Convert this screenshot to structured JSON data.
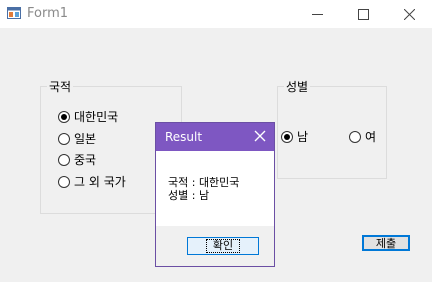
{
  "window": {
    "title": "Form1"
  },
  "nationality": {
    "title": "국적",
    "options": [
      {
        "label": "대한민국",
        "checked": true
      },
      {
        "label": "일본",
        "checked": false
      },
      {
        "label": "중국",
        "checked": false
      },
      {
        "label": "그 외 국가",
        "checked": false
      }
    ]
  },
  "gender": {
    "title": "성별",
    "options": [
      {
        "label": "남",
        "checked": true
      },
      {
        "label": "여",
        "checked": false
      }
    ]
  },
  "submit_label": "제출",
  "dialog": {
    "title": "Result",
    "line1": "국적 : 대한민국",
    "line2": "성별 : 남",
    "ok_label": "확인"
  },
  "colors": {
    "dialog_title_bg": "#7e57c2",
    "focus_border": "#0078d7"
  },
  "icons": [
    "form-app-icon",
    "minimize-icon",
    "maximize-icon",
    "close-icon",
    "dialog-close-icon"
  ]
}
